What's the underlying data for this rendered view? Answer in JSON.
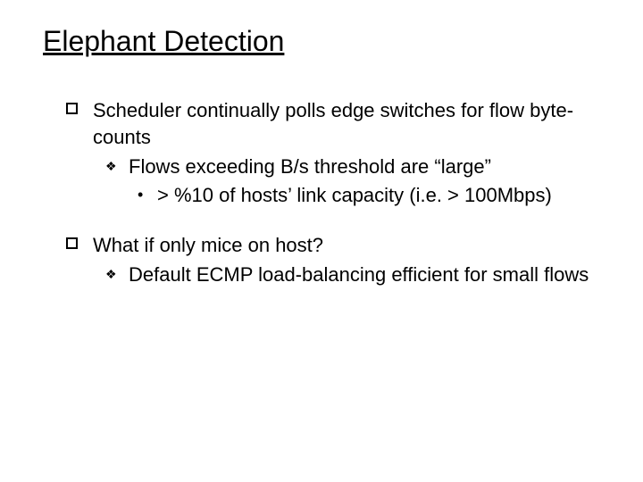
{
  "title": "Elephant Detection",
  "bullets": [
    {
      "text": "Scheduler continually polls edge switches for flow byte-counts",
      "sub": [
        {
          "text": "Flows exceeding B/s threshold are “large”",
          "sub": [
            {
              "text": "> %10 of hosts’ link capacity (i.e. > 100Mbps)"
            }
          ]
        }
      ]
    },
    {
      "text": "What if only mice on host?",
      "sub": [
        {
          "text": "Default ECMP load-balancing efficient for small flows"
        }
      ]
    }
  ]
}
